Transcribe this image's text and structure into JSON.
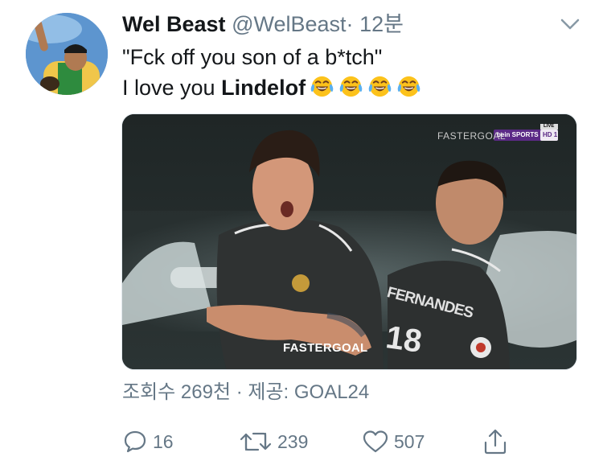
{
  "tweet": {
    "display_name": "Wel Beast",
    "handle": "@WelBeast",
    "separator": "·",
    "time": "12분",
    "text_line1": "\"Fck off you son of a b*tch\"",
    "text_line2_prefix": "I love you ",
    "text_line2_bold": "Lindelof",
    "emoji_count": 4,
    "emoji_name": "face-with-tears-of-joy"
  },
  "media": {
    "watermark_top": "FASTERGOAL",
    "broadcaster": "bein SPORTS",
    "broadcaster_channel": "HD 1",
    "live_label": "LIVE",
    "watermark_bottom": "FASTERGOAL",
    "jersey_name": "FERNANDES",
    "jersey_number": "18"
  },
  "views_line": "조회수 269천 · 제공: GOAL24",
  "actions": {
    "reply_count": "16",
    "retweet_count": "239",
    "like_count": "507"
  },
  "colors": {
    "text_primary": "#14171a",
    "text_secondary": "#657786",
    "border": "#e1e8ed"
  }
}
